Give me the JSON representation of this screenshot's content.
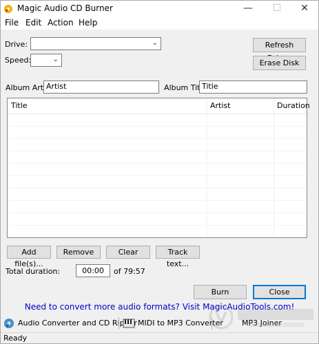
{
  "window": {
    "title": "Magic Audio CD Burner"
  },
  "window_controls": {
    "minimize": "—",
    "maximize": "☐",
    "close": "✕"
  },
  "menu": [
    "File",
    "Edit",
    "Action",
    "Help"
  ],
  "drive": {
    "label": "Drive:",
    "value": ""
  },
  "speed": {
    "label": "Speed:",
    "value": ""
  },
  "buttons": {
    "refresh_drives": "Refresh Drives",
    "erase_disk": "Erase Disk",
    "add_files": "Add file(s)...",
    "remove": "Remove",
    "clear": "Clear",
    "track_text": "Track text...",
    "burn": "Burn",
    "close": "Close"
  },
  "album": {
    "artist_label": "Album Artist:",
    "artist_value": "Artist",
    "title_label": "Album Title:",
    "title_value": "Title"
  },
  "tracklist": {
    "columns": [
      "Title",
      "Artist",
      "Duration"
    ],
    "rows": []
  },
  "duration": {
    "label": "Total duration:",
    "value": "00:00",
    "total": "of 79:57"
  },
  "promo": "Need to convert more audio formats? Visit MagicAudioTools.com!",
  "tools": [
    {
      "label": "Audio Converter and CD Ripper",
      "icon": "audio-converter-icon"
    },
    {
      "label": "MIDI to MP3 Converter",
      "icon": "midi-converter-icon"
    },
    {
      "label": "MP3 Joiner",
      "icon": "mp3-joiner-icon"
    }
  ],
  "status": "Ready",
  "colors": {
    "link": "#0000cc",
    "primary_border": "#0078d7",
    "window_bg": "#f0f0f0"
  }
}
